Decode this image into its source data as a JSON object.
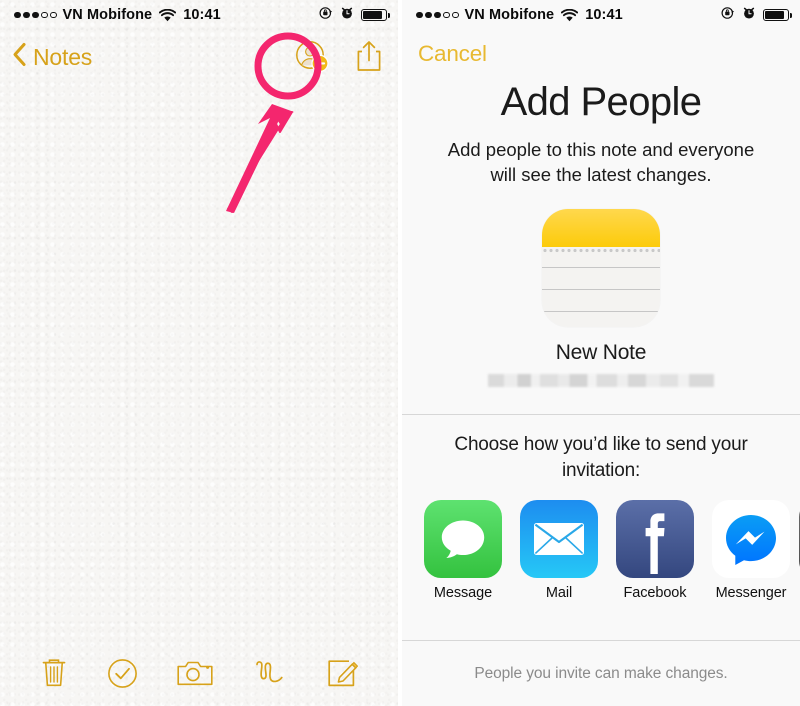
{
  "colors": {
    "notes_gold": "#d7a21a",
    "cancel_gold": "#e8b931",
    "annotation_pink": "#f4266e",
    "note_icon_yellow": "#fccb0a",
    "message_green": "#4cd964",
    "mail_blue": "#1fb6ff",
    "facebook_blue": "#3b5998",
    "messenger_blue": "#0084ff",
    "status_text": "#0a0a0a",
    "footer_grey": "#8b8b8b"
  },
  "left_screen": {
    "status_bar": {
      "signal_dots_filled": 3,
      "signal_dots_total": 5,
      "carrier": "VN Mobifone",
      "wifi_icon": "wifi-icon",
      "time": "10:41",
      "rotation_lock_icon": "rotation-lock-icon",
      "alarm_icon": "alarm-clock-icon",
      "battery_icon": "battery-icon",
      "battery_level": 88
    },
    "nav": {
      "back_icon": "chevron-left-icon",
      "back_label": "Notes",
      "add_people_icon": "add-person-icon",
      "share_icon": "share-icon"
    },
    "annotation": {
      "shape": "circle-and-arrow",
      "target": "add-people-button",
      "color": "#f4266e"
    },
    "note_content": "",
    "toolbar": [
      {
        "name": "delete-icon",
        "label": "Delete"
      },
      {
        "name": "checklist-icon",
        "label": "Checklist"
      },
      {
        "name": "camera-icon",
        "label": "Camera"
      },
      {
        "name": "sketch-icon",
        "label": "Sketch"
      },
      {
        "name": "compose-icon",
        "label": "Compose"
      }
    ]
  },
  "right_screen": {
    "status_bar": {
      "signal_dots_filled": 3,
      "signal_dots_total": 5,
      "carrier": "VN Mobifone",
      "wifi_icon": "wifi-icon",
      "time": "10:41",
      "rotation_lock_icon": "rotation-lock-icon",
      "alarm_icon": "alarm-clock-icon",
      "battery_icon": "battery-icon",
      "battery_level": 88
    },
    "nav": {
      "cancel_label": "Cancel"
    },
    "title": "Add People",
    "subtitle": "Add people to this note and everyone will see the latest changes.",
    "note_preview": {
      "icon": "notes-app-icon",
      "title": "New Note",
      "subtitle_redacted": true
    },
    "choose_prompt": "Choose how you’d like to send your invitation:",
    "share_apps": [
      {
        "label": "Message",
        "icon": "messages-app-icon",
        "color": "#4cd964"
      },
      {
        "label": "Mail",
        "icon": "mail-app-icon",
        "color": "#1fb6ff"
      },
      {
        "label": "Facebook",
        "icon": "facebook-app-icon",
        "color": "#3b5998"
      },
      {
        "label": "Messenger",
        "icon": "messenger-app-icon",
        "color": "#0084ff"
      },
      {
        "label": "",
        "icon": "more-app-icon-partial",
        "color": "#5a5a5a"
      }
    ],
    "footer": "People you invite can make changes."
  }
}
